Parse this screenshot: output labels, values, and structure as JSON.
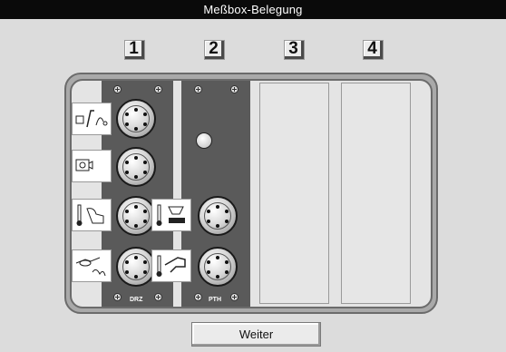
{
  "window": {
    "title": "Meßbox-Belegung"
  },
  "slots": [
    {
      "number": "1",
      "label": "DRZ"
    },
    {
      "number": "2",
      "label": "PTH"
    },
    {
      "number": "3"
    },
    {
      "number": "4"
    }
  ],
  "sensors": [
    {
      "icon": "torque-wrench-sensor-icon"
    },
    {
      "icon": "camera-sensor-icon"
    },
    {
      "icon": "temperature-probe-icon"
    },
    {
      "icon": "oil-can-sensor-icon"
    },
    {
      "icon": "thermometer-level-sensor-icon"
    },
    {
      "icon": "thermometer-fuel-nozzle-icon"
    }
  ],
  "footer": {
    "next_label": "Weiter"
  }
}
